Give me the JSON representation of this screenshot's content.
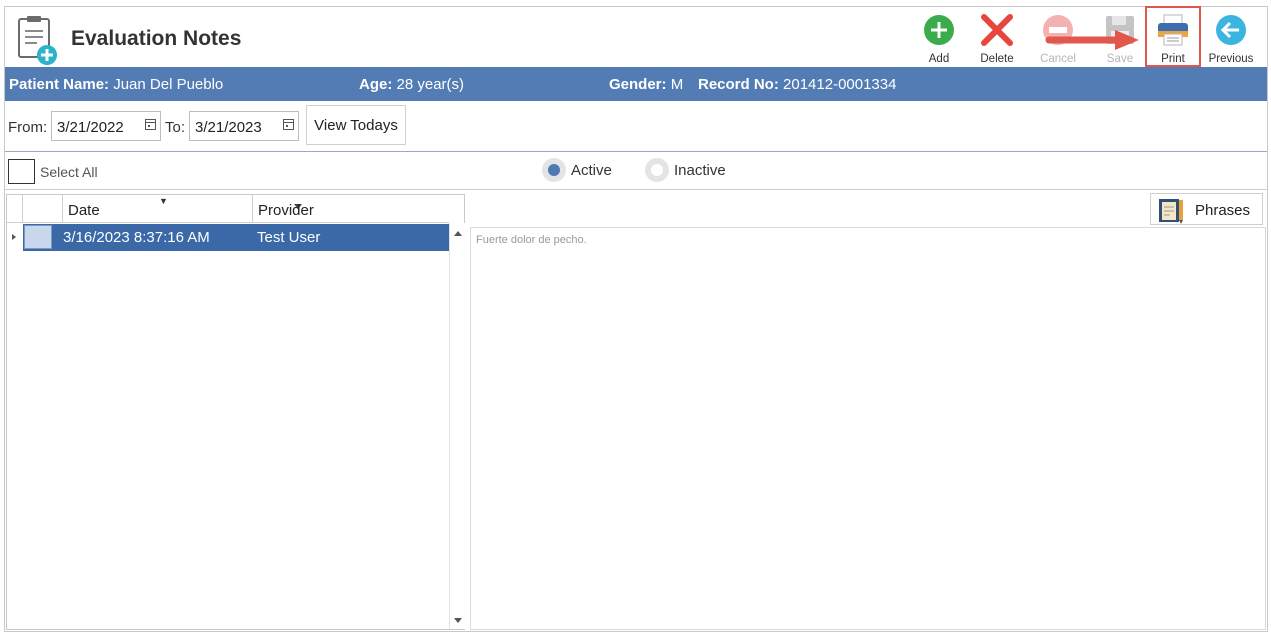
{
  "header": {
    "title": "Evaluation Notes",
    "toolbar": [
      {
        "id": "add",
        "label": "Add",
        "icon": "plus-circle-icon",
        "color": "#3aac4b",
        "enabled": true
      },
      {
        "id": "delete",
        "label": "Delete",
        "icon": "x-icon",
        "color": "#e8453c",
        "enabled": true
      },
      {
        "id": "cancel",
        "label": "Cancel",
        "icon": "minus-circle-icon",
        "color": "#f4b1b1",
        "enabled": false
      },
      {
        "id": "save",
        "label": "Save",
        "icon": "floppy-icon",
        "color": "#b9b9b9",
        "enabled": false
      },
      {
        "id": "print",
        "label": "Print",
        "icon": "printer-icon",
        "color": "#3d6fae",
        "enabled": true,
        "highlighted": true
      },
      {
        "id": "previous",
        "label": "Previous",
        "icon": "arrow-left-circle-icon",
        "color": "#3ab5e0",
        "enabled": true
      }
    ]
  },
  "patient": {
    "name_label": "Patient Name:",
    "name": "Juan Del Pueblo",
    "age_label": "Age:",
    "age": "28 year(s)",
    "gender_label": "Gender:",
    "gender": "M",
    "record_label": "Record No:",
    "record": "201412-0001334"
  },
  "filter": {
    "from_label": "From:",
    "from_value": "3/21/2022",
    "to_label": "To:",
    "to_value": "3/21/2023",
    "view_todays": "View Todays"
  },
  "selection": {
    "select_all": "Select All",
    "select_all_checked": false,
    "active_label": "Active",
    "inactive_label": "Inactive",
    "selected_status": "Active"
  },
  "grid": {
    "columns": [
      "Date",
      "Provider"
    ],
    "rows": [
      {
        "date": "3/16/2023 8:37:16 AM",
        "provider": "Test User",
        "selected": true
      }
    ]
  },
  "notes": {
    "phrases_button": "Phrases",
    "text": "Fuerte dolor de pecho."
  },
  "colors": {
    "patient_bar": "#537cb5",
    "selected_row": "#3b68a6",
    "highlight": "#e2574c"
  }
}
